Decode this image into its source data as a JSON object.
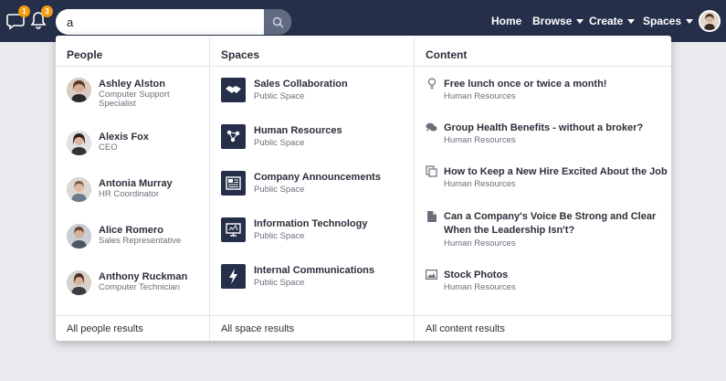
{
  "header": {
    "chat_badge": "1",
    "notification_badge": "3",
    "search_value": "a",
    "nav": {
      "home": "Home",
      "browse": "Browse",
      "create": "Create",
      "spaces": "Spaces"
    }
  },
  "dropdown": {
    "people": {
      "heading": "People",
      "footer": "All people results",
      "items": [
        {
          "name": "Ashley Alston",
          "role": "Computer Support Specialist"
        },
        {
          "name": "Alexis Fox",
          "role": "CEO"
        },
        {
          "name": "Antonia Murray",
          "role": "HR Coordinator"
        },
        {
          "name": "Alice Romero",
          "role": "Sales Representative"
        },
        {
          "name": "Anthony Ruckman",
          "role": "Computer Technician"
        }
      ]
    },
    "spaces": {
      "heading": "Spaces",
      "footer": "All space results",
      "items": [
        {
          "name": "Sales Collaboration",
          "type": "Public Space",
          "icon": "handshake-icon"
        },
        {
          "name": "Human Resources",
          "type": "Public Space",
          "icon": "people-network-icon"
        },
        {
          "name": "Company Announcements",
          "type": "Public Space",
          "icon": "newspaper-icon"
        },
        {
          "name": "Information Technology",
          "type": "Public Space",
          "icon": "monitor-icon"
        },
        {
          "name": "Internal Communications",
          "type": "Public Space",
          "icon": "lightning-icon"
        }
      ]
    },
    "content": {
      "heading": "Content",
      "footer": "All content results",
      "items": [
        {
          "title": "Free lunch once or twice a month!",
          "space": "Human Resources",
          "icon": "lightbulb-icon"
        },
        {
          "title": "Group Health Benefits - without a broker?",
          "space": "Human Resources",
          "icon": "discussion-icon"
        },
        {
          "title": "How to Keep a New Hire Excited About the Job",
          "space": "Human Resources",
          "icon": "blog-icon"
        },
        {
          "title": "Can a Company's Voice Be Strong and Clear When the Leadership Isn't?",
          "space": "Human Resources",
          "icon": "document-icon"
        },
        {
          "title": "Stock Photos",
          "space": "Human Resources",
          "icon": "image-icon"
        }
      ]
    }
  },
  "colors": {
    "navbar": "#262f4a",
    "badge": "#f39c12",
    "search_button": "#606a80",
    "space_icon_bg": "#262f4a"
  }
}
